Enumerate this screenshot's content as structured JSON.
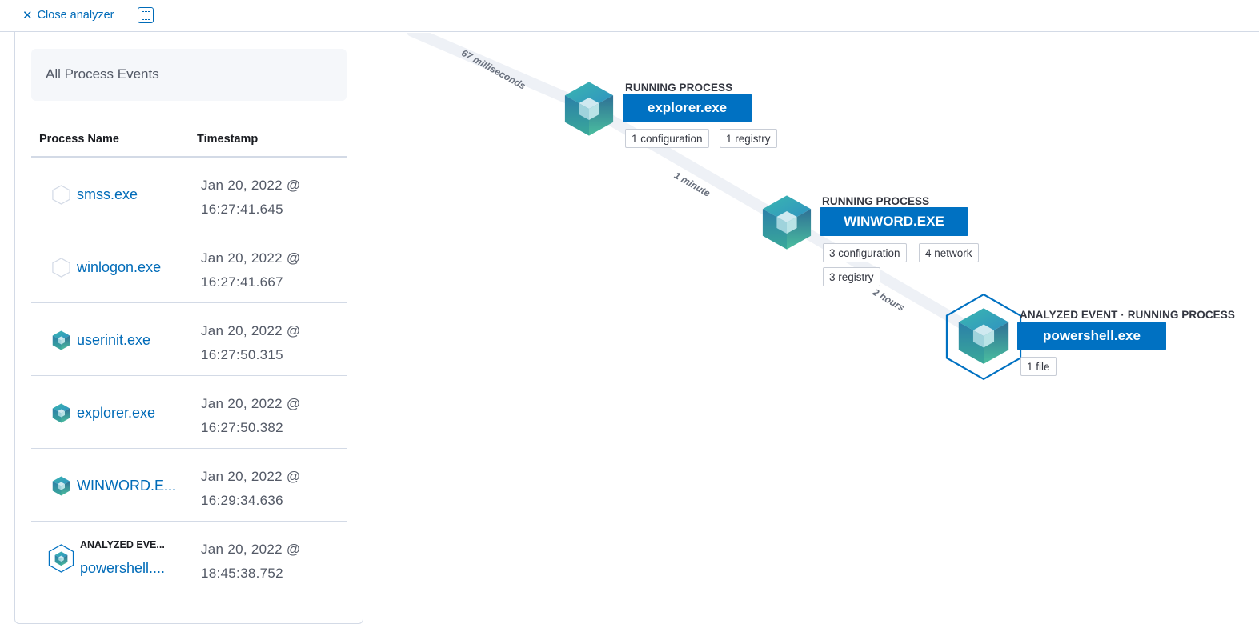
{
  "topbar": {
    "close_label": "Close analyzer"
  },
  "panel": {
    "title": "All Process Events",
    "columns": {
      "name": "Process Name",
      "timestamp": "Timestamp"
    },
    "rows": [
      {
        "name": "smss.exe",
        "date": "Jan 20, 2022 @",
        "time": "16:27:41.645",
        "icon": "hollow-hexagon-icon"
      },
      {
        "name": "winlogon.exe",
        "date": "Jan 20, 2022 @",
        "time": "16:27:41.667",
        "icon": "hollow-hexagon-icon"
      },
      {
        "name": "userinit.exe",
        "date": "Jan 20, 2022 @",
        "time": "16:27:50.315",
        "icon": "process-cube-icon"
      },
      {
        "name": "explorer.exe",
        "date": "Jan 20, 2022 @",
        "time": "16:27:50.382",
        "icon": "process-cube-icon"
      },
      {
        "name": "WINWORD.E...",
        "date": "Jan 20, 2022 @",
        "time": "16:29:34.636",
        "icon": "process-cube-icon"
      },
      {
        "label": "ANALYZED EVE...",
        "name": "powershell....",
        "date": "Jan 20, 2022 @",
        "time": "18:45:38.752",
        "icon": "analyzed-cube-icon"
      }
    ]
  },
  "graph": {
    "edges": [
      {
        "label": "67 milliseconds"
      },
      {
        "label": "1 minute"
      },
      {
        "label": "2 hours"
      }
    ],
    "nodes": [
      {
        "type": "RUNNING PROCESS",
        "name": "explorer.exe",
        "pills": [
          "1 configuration",
          "1 registry"
        ]
      },
      {
        "type": "RUNNING PROCESS",
        "name": "WINWORD.EXE",
        "pills": [
          "3 configuration",
          "4 network",
          "3 registry"
        ]
      },
      {
        "type": "ANALYZED EVENT · RUNNING PROCESS",
        "name": "powershell.exe",
        "pills": [
          "1 file"
        ]
      }
    ]
  },
  "colors": {
    "accent": "#006bb8",
    "node_button": "#0071c2",
    "cube_teal": "#2ba6a0"
  }
}
